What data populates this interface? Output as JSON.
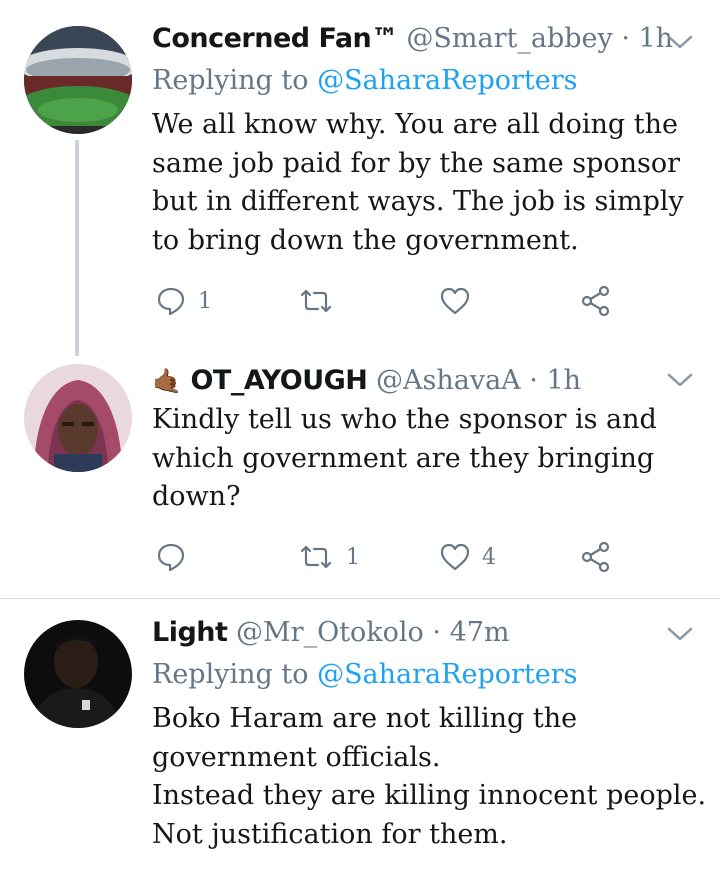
{
  "tweets": [
    {
      "name": "Concerned Fan™",
      "handle": "@Smart_abbey",
      "sep": " · ",
      "time": "1h",
      "replying_prefix": "Replying to ",
      "replying_to": "@SaharaReporters",
      "lines": [
        "We all know why. You are all doing the",
        "same job paid for by the same sponsor",
        "but in different ways. The job is simply",
        "to bring down the government."
      ],
      "reply_count": "1",
      "retweet_count": "",
      "like_count": "",
      "avatar_icon": "stadium-avatar"
    },
    {
      "name_emoji": "🤙🏾",
      "name": "OT_AYOUGH",
      "handle": "@AshavaA",
      "sep": " · ",
      "time": "1h",
      "lines": [
        "Kindly tell us who the sponsor is and",
        "which government are they bringing",
        "down?"
      ],
      "reply_count": "",
      "retweet_count": "1",
      "like_count": "4",
      "avatar_icon": "hooded-person-avatar"
    },
    {
      "name": "Light",
      "handle": "@Mr_Otokolo",
      "sep": " · ",
      "time": "47m",
      "replying_prefix": "Replying to ",
      "replying_to": "@SaharaReporters",
      "lines": [
        "Boko Haram are not killing the",
        "government officials.",
        "Instead they are killing innocent people.",
        "Not justification for them."
      ],
      "avatar_icon": "dark-portrait-avatar"
    }
  ],
  "colors": {
    "secondary_text": "#657786",
    "link": "#1da1f2",
    "thread_line": "#c8d3dc",
    "divider": "#dcdfe2"
  }
}
